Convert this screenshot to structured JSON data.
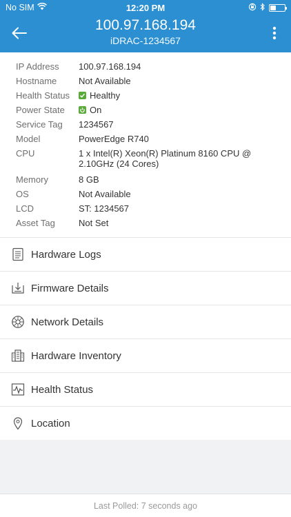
{
  "status_bar": {
    "carrier": "No SIM",
    "time": "12:20 PM"
  },
  "header": {
    "title": "100.97.168.194",
    "subtitle": "iDRAC-1234567",
    "accent_color": "#2b8fd1"
  },
  "details": [
    {
      "label": "IP Address",
      "value": "100.97.168.194"
    },
    {
      "label": "Hostname",
      "value": "Not Available"
    },
    {
      "label": "Health Status",
      "value": "Healthy",
      "icon": "check-icon",
      "icon_color": "#5aaa3a"
    },
    {
      "label": "Power State",
      "value": "On",
      "icon": "power-icon",
      "icon_color": "#5aaa3a"
    },
    {
      "label": "Service Tag",
      "value": "1234567"
    },
    {
      "label": "Model",
      "value": "PowerEdge R740"
    },
    {
      "label": "CPU",
      "value": "1 x Intel(R) Xeon(R) Platinum 8160 CPU @ 2.10GHz (24 Cores)"
    },
    {
      "label": "Memory",
      "value": "8 GB"
    },
    {
      "label": "OS",
      "value": "Not Available"
    },
    {
      "label": "LCD",
      "value": "ST: 1234567"
    },
    {
      "label": "Asset Tag",
      "value": "Not Set"
    }
  ],
  "menu": [
    {
      "label": "Hardware Logs",
      "icon": "document-list-icon"
    },
    {
      "label": "Firmware Details",
      "icon": "download-tray-icon"
    },
    {
      "label": "Network Details",
      "icon": "network-globe-icon"
    },
    {
      "label": "Hardware Inventory",
      "icon": "server-rack-icon"
    },
    {
      "label": "Health Status",
      "icon": "heart-pulse-icon"
    },
    {
      "label": "Location",
      "icon": "map-pin-icon"
    }
  ],
  "footer": {
    "last_polled": "Last Polled: 7 seconds ago"
  }
}
